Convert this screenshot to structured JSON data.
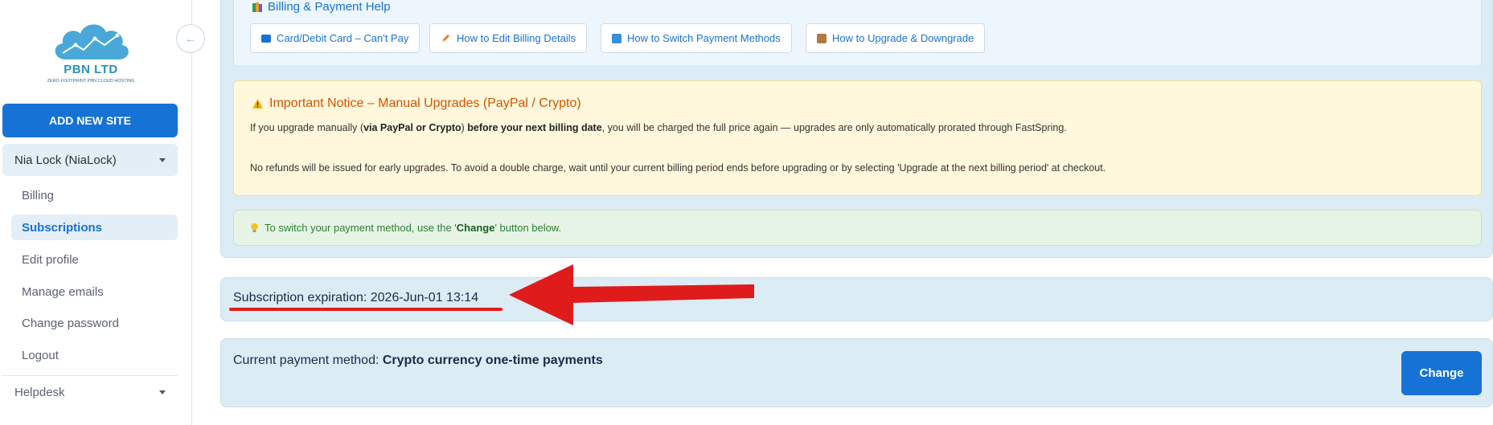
{
  "sidebar": {
    "logo_name": "PBN LTD",
    "logo_tagline": "ZERO FOOTPRINT PBN CLOUD HOSTING",
    "add_site_label": "ADD NEW SITE",
    "user_label": "Nia Lock (NiaLock)",
    "items": [
      {
        "label": "Billing",
        "active": false
      },
      {
        "label": "Subscriptions",
        "active": true
      },
      {
        "label": "Edit profile",
        "active": false
      },
      {
        "label": "Manage emails",
        "active": false
      },
      {
        "label": "Change password",
        "active": false
      },
      {
        "label": "Logout",
        "active": false
      }
    ],
    "helpdesk_label": "Helpdesk"
  },
  "help": {
    "title": "Billing & Payment Help",
    "links": [
      {
        "label": "Card/Debit Card – Can't Pay",
        "icon": "credit-card-icon"
      },
      {
        "label": "How to Edit Billing Details",
        "icon": "pencil-icon"
      },
      {
        "label": "How to Switch Payment Methods",
        "icon": "switch-icon"
      },
      {
        "label": "How to Upgrade & Downgrade",
        "icon": "package-icon"
      }
    ]
  },
  "notice": {
    "title": "Important Notice – Manual Upgrades (PayPal / Crypto)",
    "p1_a": "If you upgrade manually (",
    "p1_b": "via PayPal or Crypto",
    "p1_c": ") ",
    "p1_d": "before your next billing date",
    "p1_e": ", you will be charged the full price again — upgrades are only automatically prorated through FastSpring.",
    "p2": "No refunds will be issued for early upgrades. To avoid a double charge, wait until your current billing period ends before upgrading or by selecting 'Upgrade at the next billing period' at checkout."
  },
  "tip": {
    "prefix": "To switch your payment method, use the '",
    "highlight": "Change",
    "suffix": "' button below."
  },
  "subscription": {
    "label": "Subscription expiration: 2026-Jun-01 13:14"
  },
  "payment": {
    "label": "Current payment method: ",
    "method": "Crypto currency one-time payments",
    "change_label": "Change"
  },
  "colors": {
    "primary": "#1672d4",
    "annotation": "#e01b1b",
    "notice": "#d35400"
  }
}
